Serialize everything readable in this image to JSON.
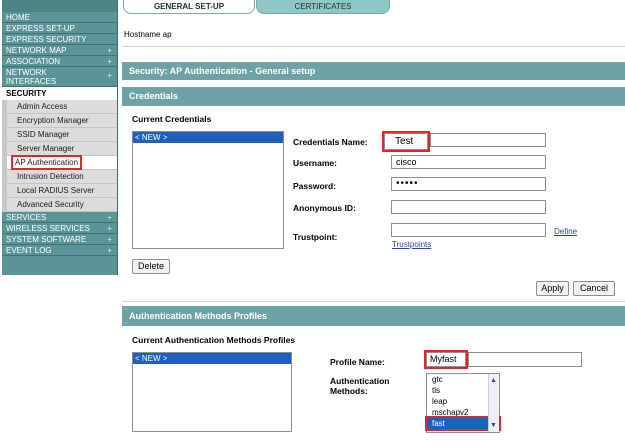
{
  "sidebar": {
    "items_top": [
      {
        "label": "HOME",
        "plus": ""
      },
      {
        "label": "EXPRESS SET-UP",
        "plus": ""
      },
      {
        "label": "EXPRESS SECURITY",
        "plus": ""
      },
      {
        "label": "NETWORK MAP",
        "plus": "+"
      },
      {
        "label": "ASSOCIATION",
        "plus": "+"
      },
      {
        "label": "NETWORK INTERFACES",
        "plus": "+"
      }
    ],
    "section": "SECURITY",
    "sub_items": [
      "Admin Access",
      "Encryption Manager",
      "SSID Manager",
      "Server Manager",
      "AP Authentication",
      "Intrusion Detection",
      "Local RADIUS Server",
      "Advanced Security"
    ],
    "items_bottom": [
      {
        "label": "SERVICES",
        "plus": "+"
      },
      {
        "label": "WIRELESS SERVICES",
        "plus": "+"
      },
      {
        "label": "SYSTEM SOFTWARE",
        "plus": "+"
      },
      {
        "label": "EVENT LOG",
        "plus": "+"
      }
    ]
  },
  "tabs": {
    "general": "GENERAL SET-UP",
    "certificates": "CERTIFICATES"
  },
  "hostname": "Hostname ap",
  "security_title": "Security: AP Authentication - General setup",
  "credentials": {
    "bar": "Credentials",
    "current_label": "Current Credentials",
    "list_selected": "< NEW >",
    "name_label": "Credentials Name:",
    "name_value": "Test",
    "username_label": "Username:",
    "username_value": "cisco",
    "password_label": "Password:",
    "password_value": "•••••",
    "anon_label": "Anonymous ID:",
    "anon_value": "",
    "trustpoint_label": "Trustpoint:",
    "trustpoint_value": "",
    "trustpoints_link": "Trustpoints",
    "define_link": "Define",
    "delete_button": "Delete",
    "apply_button": "Apply",
    "cancel_button": "Cancel"
  },
  "auth_methods": {
    "bar": "Authentication Methods Profiles",
    "current_label": "Current Authentication Methods Profiles",
    "list_selected": "< NEW >",
    "profile_label": "Profile Name:",
    "profile_value": "Myfast",
    "methods_label": "Authentication Methods:",
    "options": [
      "gtc",
      "tls",
      "leap",
      "mschapv2",
      "fast"
    ],
    "selected_option": "fast"
  },
  "colors": {
    "sidebar": "#5b9497",
    "bar": "#6ea3a5",
    "highlight": "#e0262d",
    "selection": "#1f5fbf"
  }
}
